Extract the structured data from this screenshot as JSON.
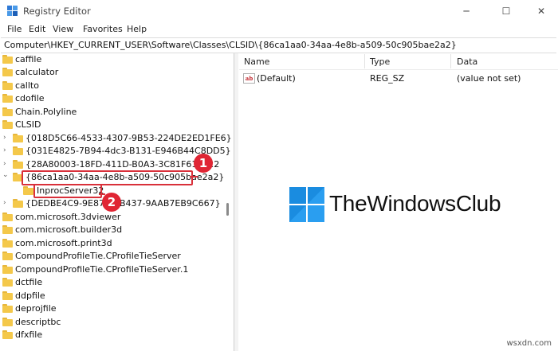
{
  "window": {
    "title": "Registry Editor",
    "minimize": "─",
    "maximize": "☐",
    "close": "✕"
  },
  "menu": [
    "File",
    "Edit",
    "View",
    "Favorites",
    "Help"
  ],
  "address": "Computer\\HKEY_CURRENT_USER\\Software\\Classes\\CLSID\\{86ca1aa0-34aa-4e8b-a509-50c905bae2a2}",
  "tree": {
    "items": [
      {
        "label": "caffile"
      },
      {
        "label": "calculator"
      },
      {
        "label": "callto"
      },
      {
        "label": "cdofile"
      },
      {
        "label": "Chain.Polyline"
      },
      {
        "label": "CLSID"
      },
      {
        "label": "{018D5C66-4533-4307-9B53-224DE2ED1FE6}"
      },
      {
        "label": "{031E4825-7B94-4dc3-B131-E946B44C8DD5}"
      },
      {
        "label": "{28A80003-18FD-411D-B0A3-3C81F618E22"
      },
      {
        "label": "{86ca1aa0-34aa-4e8b-a509-50c905bae2a2}"
      },
      {
        "label": "InprocServer32"
      },
      {
        "label": "{DEDBE4C9-9E87"
      },
      {
        "label": "B437-9AAB7EB9C667}"
      },
      {
        "label": "com.microsoft.3dviewer"
      },
      {
        "label": "com.microsoft.builder3d"
      },
      {
        "label": "com.microsoft.print3d"
      },
      {
        "label": "CompoundProfileTie.CProfileTieServer"
      },
      {
        "label": "CompoundProfileTie.CProfileTieServer.1"
      },
      {
        "label": "dctfile"
      },
      {
        "label": "ddpfile"
      },
      {
        "label": "deprojfile"
      },
      {
        "label": "descriptbc"
      },
      {
        "label": "dfxfile"
      }
    ],
    "chevrons": {
      "collapsed": "›",
      "expanded": "⌄"
    }
  },
  "callouts": [
    "1",
    "2"
  ],
  "values_pane": {
    "columns": [
      "Name",
      "Type",
      "Data"
    ],
    "rows": [
      {
        "icon": "ab",
        "name": "(Default)",
        "type": "REG_SZ",
        "data": "(value not set)"
      }
    ]
  },
  "logo": {
    "text": "TheWindowsClub"
  },
  "watermark": "wsxdn.com",
  "colors": {
    "callout_red": "#e02634",
    "folder_yellow": "#f4c84a",
    "logo_blue": "#1a8ce0"
  }
}
